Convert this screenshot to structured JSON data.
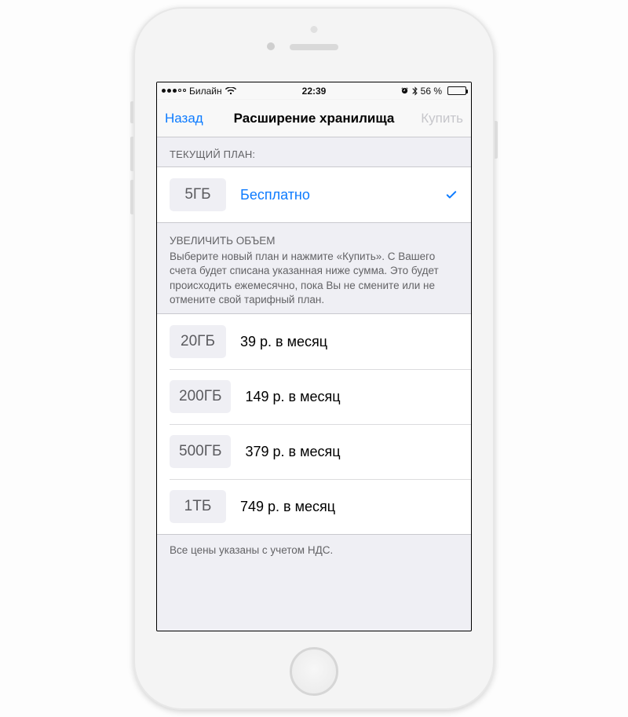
{
  "statusbar": {
    "carrier": "Билайн",
    "time": "22:39",
    "battery_text": "56 %"
  },
  "navbar": {
    "back": "Назад",
    "title": "Расширение хранилища",
    "buy": "Купить"
  },
  "current_plan": {
    "header": "ТЕКУЩИЙ ПЛАН:",
    "size": "5ГБ",
    "label": "Бесплатно"
  },
  "upgrade": {
    "header": "УВЕЛИЧИТЬ ОБЪЕМ",
    "description": "Выберите новый план и нажмите «Купить». С Вашего счета будет списана указанная ниже сумма. Это будет происходить ежемесячно, пока Вы не смените или не отмените свой тарифный план.",
    "plans": [
      {
        "size": "20ГБ",
        "label": "39 р. в месяц"
      },
      {
        "size": "200ГБ",
        "label": "149 р. в месяц"
      },
      {
        "size": "500ГБ",
        "label": "379 р. в месяц"
      },
      {
        "size": "1ТБ",
        "label": "749 р. в месяц"
      }
    ]
  },
  "footer": "Все цены указаны с учетом НДС."
}
